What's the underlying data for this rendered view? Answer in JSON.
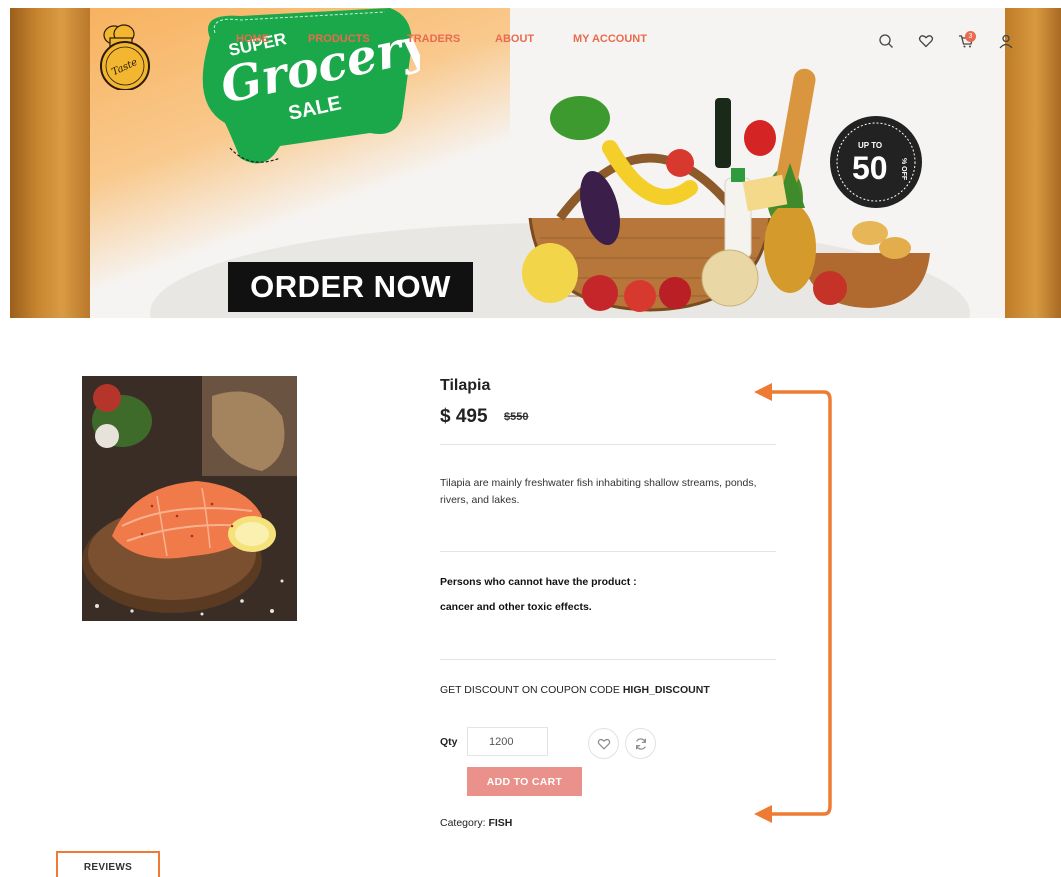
{
  "nav": {
    "links": [
      "HOME",
      "PRODUCTS",
      "TRADERS",
      "ABOUT",
      "MY ACCOUNT"
    ],
    "cart_count": "3",
    "icons": [
      "search-icon",
      "heart-icon",
      "cart-icon",
      "user-icon"
    ]
  },
  "banner": {
    "logo_text": "TasteBest",
    "promo_top": "SUPER",
    "promo_main": "Grocery",
    "promo_bottom": "SALE",
    "cta": "ORDER NOW",
    "discount_prefix": "UP TO",
    "discount_value": "50",
    "discount_suffix": "% OFF"
  },
  "product": {
    "title": "Tilapia",
    "price": "$ 495",
    "old_price": "$550",
    "description": "Tilapia are mainly freshwater fish inhabiting shallow streams, ponds, rivers, and lakes.",
    "restriction_title": "Persons who cannot have the product :",
    "restriction_text": "cancer and other toxic effects.",
    "coupon_prefix": "GET DISCOUNT ON COUPON CODE",
    "coupon_code": "HIGH_DISCOUNT",
    "qty_label": "Qty",
    "qty_value": "1200",
    "add_to_cart": "ADD TO CART",
    "category_label": "Category:",
    "category_value": "FISH"
  },
  "tabs": {
    "reviews": "REVIEWS"
  },
  "colors": {
    "accent": "#e96b4d",
    "button": "#e9918a",
    "annotation": "#ee7b33",
    "promo_green": "#1aa84a"
  }
}
